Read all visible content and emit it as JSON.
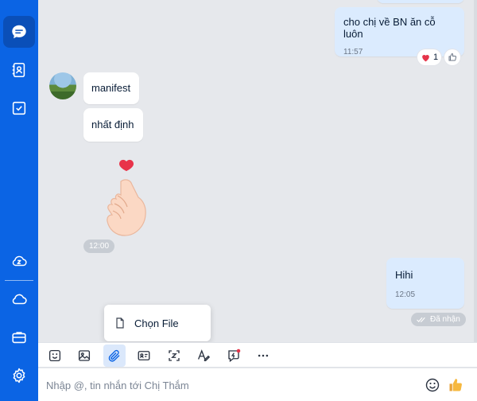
{
  "messages": {
    "outgoing_1": {
      "text": "cho chị về BN ăn cỗ luôn",
      "time": "11:57",
      "reaction_count": "1"
    },
    "incoming_1": {
      "text": "manifest"
    },
    "incoming_2": {
      "text": "nhất định"
    },
    "sticker_time": "12:00",
    "outgoing_2": {
      "text": "Hihi",
      "time": "12:05",
      "status": "Đã nhận"
    }
  },
  "attach_menu": {
    "choose_file": "Chọn File"
  },
  "composer": {
    "placeholder": "Nhập @, tin nhắn tới Chị Thắm"
  },
  "colors": {
    "sidebar": "#0b64e4",
    "outgoing_bubble": "#dbebfe",
    "accent": "#0b64e4"
  },
  "icons": {
    "sidebar": [
      "chat-icon",
      "contacts-icon",
      "todo-icon",
      "zcloud-icon",
      "cloud-icon",
      "briefcase-icon",
      "settings-icon"
    ],
    "toolbar": [
      "sticker-icon",
      "image-icon",
      "attach-icon",
      "contact-card-icon",
      "screenshot-icon",
      "text-format-icon",
      "quick-message-icon",
      "more-icon"
    ]
  }
}
